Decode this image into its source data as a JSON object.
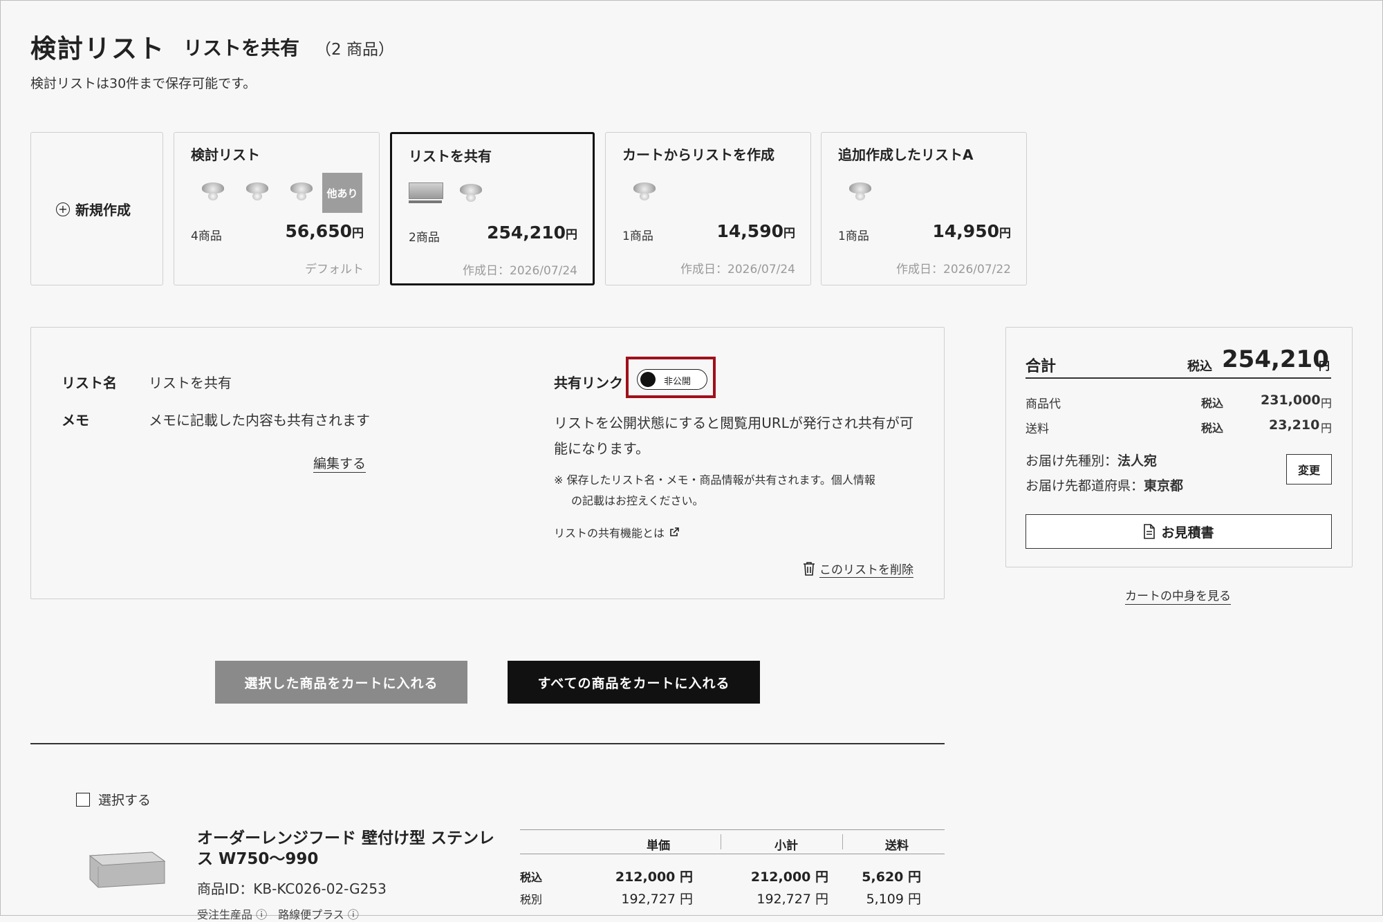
{
  "header": {
    "title": "検討リスト",
    "list_name": "リストを共有",
    "count": "（2 商品）",
    "note": "検討リストは30件まで保存可能です。"
  },
  "new_card": {
    "label": "新規作成"
  },
  "lists": [
    {
      "name": "検討リスト",
      "items": "4商品",
      "price": "56,650",
      "yen": "円",
      "footer": "デフォルト",
      "more": "他あり"
    },
    {
      "name": "リストを共有",
      "items": "2商品",
      "price": "254,210",
      "yen": "円",
      "footer": "作成日：2026/07/24"
    },
    {
      "name": "カートからリストを作成",
      "items": "1商品",
      "price": "14,590",
      "yen": "円",
      "footer": "作成日：2026/07/24"
    },
    {
      "name": "追加作成したリストA",
      "items": "1商品",
      "price": "14,950",
      "yen": "円",
      "footer": "作成日：2026/07/22"
    }
  ],
  "detail": {
    "name_label": "リスト名",
    "name_value": "リストを共有",
    "memo_label": "メモ",
    "memo_value": "メモに記載した内容も共有されます",
    "edit": "編集する",
    "share_label": "共有リンク",
    "toggle_state": "非公開",
    "share_desc": "リストを公開状態にすると閲覧用URLが発行され共有が可能になります。",
    "share_note_1": "※ 保存したリスト名・メモ・商品情報が共有されます。個人情報",
    "share_note_2": "の記載はお控えください。",
    "share_help": "リストの共有機能とは",
    "delete": "このリストを削除"
  },
  "summary": {
    "total_label": "合計",
    "tax_in": "税込",
    "total": "254,210",
    "yen": "円",
    "item_label": "商品代",
    "item_price": "231,000",
    "ship_label": "送料",
    "ship_price": "23,210",
    "dest_type_label": "お届け先種別：",
    "dest_type": "法人宛",
    "dest_pref_label": "お届け先都道府県：",
    "dest_pref": "東京都",
    "change": "変更",
    "quote": "お見積書",
    "cart_link": "カートの中身を見る"
  },
  "actions": {
    "add_selected": "選択した商品をカートに入れる",
    "add_all": "すべての商品をカートに入れる"
  },
  "product": {
    "select": "選択する",
    "name": "オーダーレンジフード 壁付け型 ステンレス W750〜990",
    "id": "商品ID：KB-KC026-02-G253",
    "tags": "受注生産品 ⓘ　路線便プラス ⓘ",
    "col_unit": "単価",
    "col_subtotal": "小計",
    "col_ship": "送料",
    "tax_in": "税込",
    "tax_ex": "税別",
    "unit_in": "212,000 円",
    "unit_ex": "192,727 円",
    "sub_in": "212,000 円",
    "sub_ex": "192,727 円",
    "ship_in": "5,620 円",
    "ship_ex": "5,109 円"
  }
}
